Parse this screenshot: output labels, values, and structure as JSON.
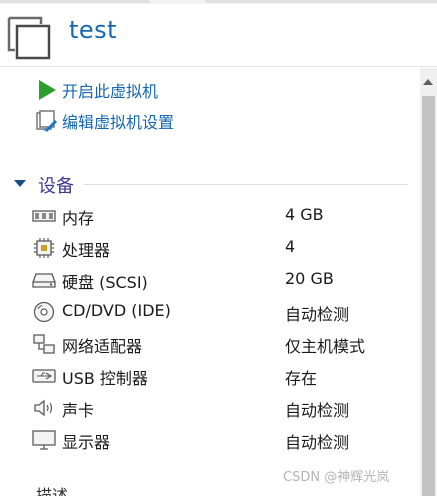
{
  "vm": {
    "title": "test"
  },
  "actions": [
    {
      "label": "开启此虚拟机",
      "icon": "play-icon"
    },
    {
      "label": "编辑虚拟机设置",
      "icon": "edit-settings-icon"
    }
  ],
  "devices": {
    "section_title": "设备",
    "items": [
      {
        "name": "内存",
        "value": "4 GB",
        "icon": "memory-icon"
      },
      {
        "name": "处理器",
        "value": "4",
        "icon": "processor-icon"
      },
      {
        "name": "硬盘 (SCSI)",
        "value": "20 GB",
        "icon": "hard-disk-icon"
      },
      {
        "name": "CD/DVD (IDE)",
        "value": "自动检测",
        "icon": "cd-dvd-icon"
      },
      {
        "name": "网络适配器",
        "value": "仅主机模式",
        "icon": "network-adapter-icon"
      },
      {
        "name": "USB 控制器",
        "value": "存在",
        "icon": "usb-icon"
      },
      {
        "name": "声卡",
        "value": "自动检测",
        "icon": "sound-card-icon"
      },
      {
        "name": "显示器",
        "value": "自动检测",
        "icon": "display-icon"
      }
    ]
  },
  "next_section_title": "描述",
  "watermark": "CSDN @神辉光岚",
  "colors": {
    "link": "#1467b3",
    "section_title": "#3f3a8f",
    "play_green": "#2e9e2e"
  }
}
